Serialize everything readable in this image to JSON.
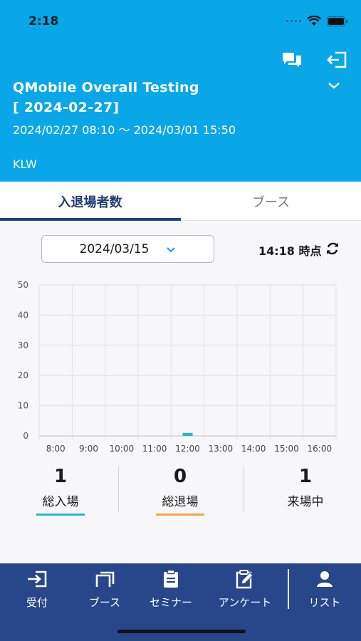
{
  "status_bar": {
    "time": "2:18"
  },
  "header": {
    "event_title": "QMobile Overall Testing",
    "event_date": "[ 2024-02-27]",
    "event_period": "2024/02/27 08:10 ～ 2024/03/01 15:50",
    "organizer": "KLW",
    "icons": [
      "chat-icon",
      "logout-icon",
      "chevron-down-icon"
    ]
  },
  "tabs": [
    {
      "label": "入退場者数",
      "active": true
    },
    {
      "label": "ブース",
      "active": false
    }
  ],
  "filter": {
    "date_value": "2024/03/15",
    "as_of": "14:18 時点"
  },
  "chart_data": {
    "type": "bar",
    "categories": [
      "8:00",
      "9:00",
      "10:00",
      "11:00",
      "12:00",
      "13:00",
      "14:00",
      "15:00",
      "16:00"
    ],
    "series": [
      {
        "values": [
          0,
          0,
          0,
          0,
          1,
          0,
          0,
          0,
          0
        ],
        "color": "#1fb6d1"
      }
    ],
    "ylim": [
      0,
      50
    ],
    "yticks": [
      0,
      10,
      20,
      30,
      40,
      50
    ],
    "grid": true
  },
  "stats": [
    {
      "value": "1",
      "label": "総入場",
      "color": "#1fb6d1"
    },
    {
      "value": "0",
      "label": "総退場",
      "color": "#f2a447"
    },
    {
      "value": "1",
      "label": "来場中",
      "color": ""
    }
  ],
  "bottom_nav": [
    {
      "label": "受付",
      "icon": "login-icon"
    },
    {
      "label": "ブース",
      "icon": "booth-icon"
    },
    {
      "label": "セミナー",
      "icon": "clipboard-icon"
    },
    {
      "label": "アンケート",
      "icon": "survey-edit-icon"
    },
    {
      "label": "リスト",
      "icon": "person-icon"
    }
  ]
}
